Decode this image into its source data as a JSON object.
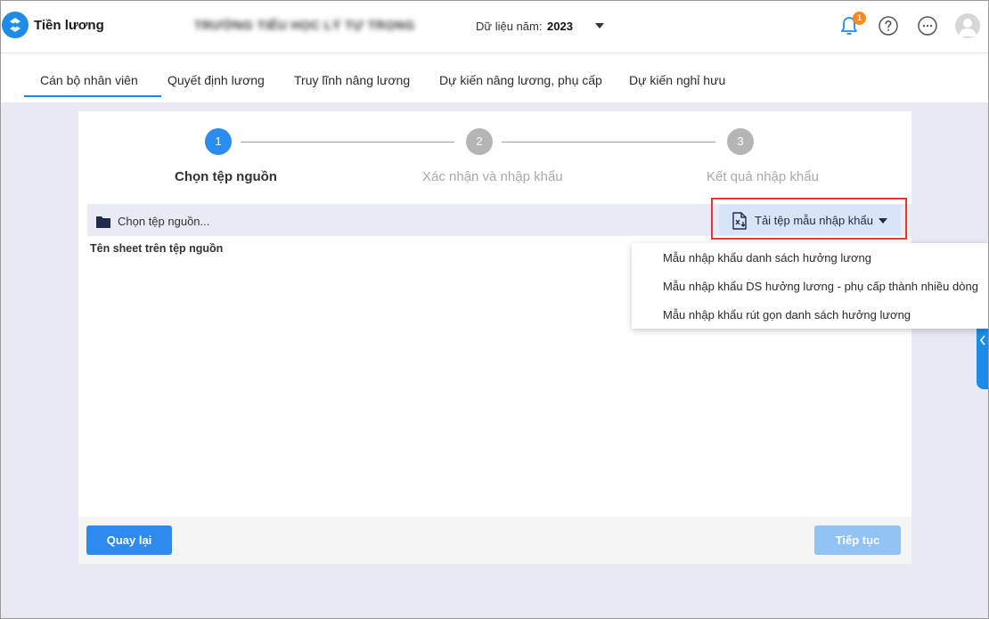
{
  "header": {
    "app_title": "Tiền lương",
    "school_name": "TRƯỜNG TIỂU HỌC LÝ TỰ TRỌNG",
    "year_label": "Dữ liệu năm:",
    "year_value": "2023",
    "notification_count": "1",
    "icons": [
      "logo-icon",
      "bell-icon",
      "help-icon",
      "more-icon",
      "avatar-icon"
    ]
  },
  "tabs": [
    {
      "label": "Cán bộ nhân viên",
      "active": true
    },
    {
      "label": "Quyết định lương",
      "active": false
    },
    {
      "label": "Truy lĩnh nâng lương",
      "active": false
    },
    {
      "label": "Dự kiến nâng lương, phụ cấp",
      "active": false
    },
    {
      "label": "Dự kiến nghỉ hưu",
      "active": false
    }
  ],
  "wizard": {
    "steps": [
      {
        "number": "1",
        "label": "Chọn tệp nguồn",
        "state": "active"
      },
      {
        "number": "2",
        "label": "Xác nhận và nhập khẩu",
        "state": "pending"
      },
      {
        "number": "3",
        "label": "Kết quả nhập khẩu",
        "state": "pending"
      }
    ],
    "source_picker": "Chọn tệp nguồn...",
    "sheet_label": "Tên sheet trên tệp nguồn",
    "download_button": "Tải tệp mẫu nhập khẩu",
    "back_button": "Quay lại",
    "next_button": "Tiếp tục"
  },
  "template_menu": [
    "Mẫu nhập khẩu danh sách hưởng lương",
    "Mẫu nhập khẩu DS hưởng lương - phụ cấp thành nhiều dòng",
    "Mẫu nhập khẩu rút gọn danh sách hưởng lương"
  ],
  "colors": {
    "accent": "#1f86e8",
    "step_active": "#2b8cf0",
    "step_pending": "#b5b5b5",
    "highlight": "#e53935",
    "badge": "#ff8a1c",
    "page_bg": "#e8e9f3"
  }
}
